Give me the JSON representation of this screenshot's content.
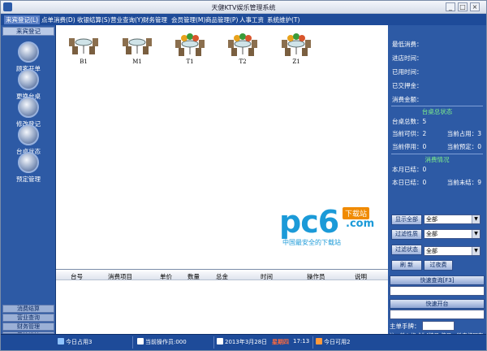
{
  "window": {
    "title": "天健KTV娱乐管理系统",
    "controls": [
      "_",
      "□",
      "×"
    ]
  },
  "menubar": {
    "items": [
      "来宾登记(L)",
      "点单消费(D)",
      "收银结算(S)",
      "营业查询(Y)",
      "财务管理",
      "会员管理(M)",
      "商品管理(P)",
      "人事工资",
      "系统维护(T)"
    ]
  },
  "sidebar": {
    "top_label": "来宾登记",
    "buttons": [
      {
        "label": "顾客开单",
        "icon": "customer-order-icon"
      },
      {
        "label": "更换台桌",
        "icon": "change-table-icon"
      },
      {
        "label": "修改登记",
        "icon": "edit-registration-icon"
      },
      {
        "label": "台桌状态",
        "icon": "table-status-icon"
      },
      {
        "label": "预定管理",
        "icon": "reservation-icon"
      }
    ],
    "bottom_items": [
      "消费结算",
      "营业查询",
      "财务管理",
      "系统维护"
    ]
  },
  "tables": [
    {
      "label": "B1",
      "occupied": false
    },
    {
      "label": "M1",
      "occupied": false
    },
    {
      "label": "T1",
      "occupied": true
    },
    {
      "label": "T2",
      "occupied": true
    },
    {
      "label": "Z1",
      "occupied": true
    }
  ],
  "watermark": {
    "main": "pc6",
    "box": "下载站",
    "com": ".com",
    "sub": "中国最安全的下载站"
  },
  "detail_table": {
    "columns": [
      "台号",
      "消费项目",
      "单价",
      "数量",
      "总金",
      "时间",
      "操作员",
      "说明"
    ]
  },
  "info_panel": {
    "fields": [
      "最低消费：",
      "进店时间：",
      "已用时间：",
      "已交押金：",
      "消费金额："
    ],
    "status_title": "台桌总状态",
    "total_tables": "台桌总数：5",
    "available": "当前可供：2",
    "occupied": "当前占用：3",
    "disabled": "当前停用：0",
    "reserved": "当前预定：0",
    "consume_title": "消费情况",
    "month_settled": "本月已结：0",
    "today_settled": "本日已结：0",
    "current_unsettled": "当前未结：9"
  },
  "filters": {
    "show_all_label": "显示全部",
    "filter_type_label": "过滤性质",
    "filter_status_label": "过滤状态",
    "select_value": "全部",
    "refresh_label": "刷  新",
    "overnight_label": "过夜费"
  },
  "quick": {
    "query_label": "快速查询[F3]",
    "open_label": "快速开台",
    "host_label": "主单手牌：",
    "hint": "注：输入格式为[牌号-牌号，输完按回车"
  },
  "statusbar": {
    "today_used": "今日占用3",
    "operator": "当前操作员:000",
    "date": "2013年3月28日",
    "weekday": "星期四",
    "time": "17:13",
    "today_available": "今日可用2"
  },
  "colors": {
    "menubar": "#1e4b99",
    "sidebar": "#2d5aa5",
    "section_title": "#7ff08a",
    "weekday": "#ff6a3d"
  }
}
